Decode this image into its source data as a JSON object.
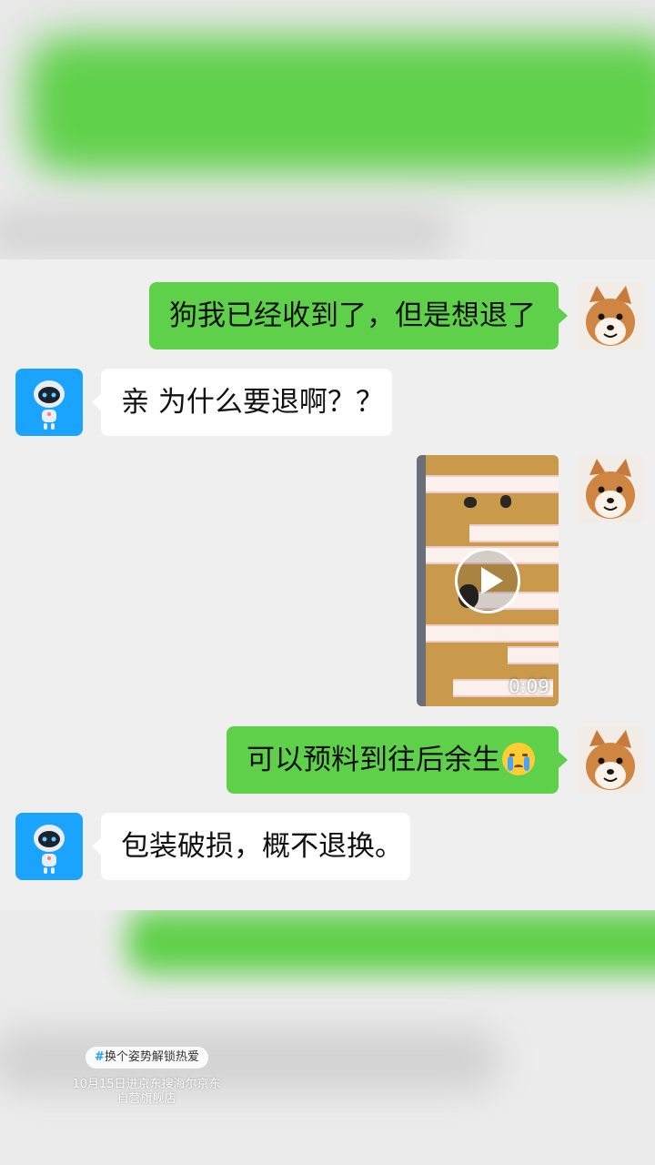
{
  "messages": [
    {
      "side": "right",
      "text": "狗我已经收到了，但是想退了"
    },
    {
      "side": "left",
      "text": "亲 为什么要退啊？？"
    },
    {
      "side": "right",
      "video_duration": "0:09"
    },
    {
      "side": "right",
      "text": "可以预料到往后余生",
      "emoji": "crying-face-emoji"
    },
    {
      "side": "left",
      "text": "包装破损，概不退换。"
    }
  ],
  "overlay": {
    "tag_hash": "#",
    "tag_text": "换个姿势解锁热爱",
    "caption": "10月15日进京东搜海尔京东自营旗舰店"
  },
  "colors": {
    "sent_bubble": "#5fd04a",
    "received_bubble": "#ffffff",
    "background": "#efefef",
    "robot_avatar": "#1aa3ff"
  }
}
